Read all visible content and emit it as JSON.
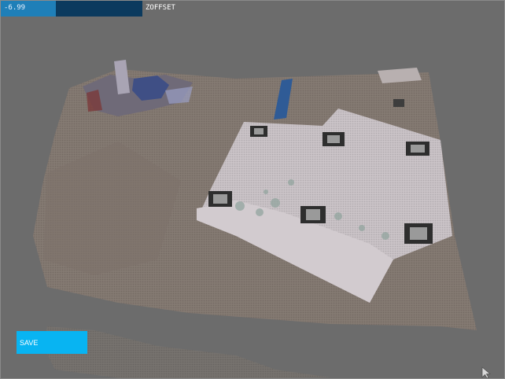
{
  "slider": {
    "value_text": "-6.99",
    "label": "ZOFFSET",
    "fill_fraction": 0.39
  },
  "save_button": {
    "label": "SAVE"
  },
  "scene": {
    "description_colors": {
      "background": "#6c6c6c",
      "floor": "#8a7d72",
      "paper": "#c8c0c4",
      "accent_blue": "#3a5f9e"
    }
  }
}
